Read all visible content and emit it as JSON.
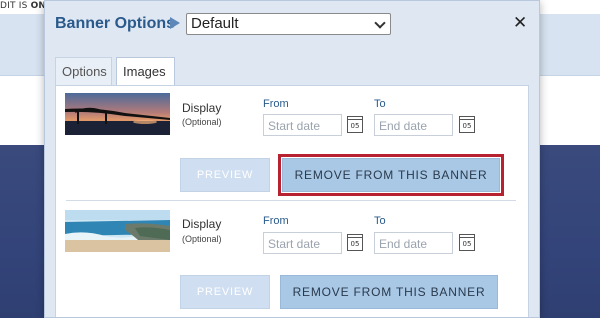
{
  "background": {
    "topbar_text": "DIT IS ON"
  },
  "dialog": {
    "title": "Banner Options",
    "banner_select": {
      "selected": "Default"
    },
    "tabs": [
      {
        "label": "Options",
        "active": false
      },
      {
        "label": "Images",
        "active": true
      }
    ],
    "images": [
      {
        "thumbnail": "bridge-sunset-image",
        "display_label": "Display",
        "optional_label": "(Optional)",
        "from_label": "From",
        "to_label": "To",
        "start_placeholder": "Start date",
        "end_placeholder": "End date",
        "calendar_day": "05",
        "preview_label": "PREVIEW",
        "remove_label": "REMOVE FROM THIS BANNER",
        "remove_focused": true
      },
      {
        "thumbnail": "beach-coast-image",
        "display_label": "Display",
        "optional_label": "(Optional)",
        "from_label": "From",
        "to_label": "To",
        "start_placeholder": "Start date",
        "end_placeholder": "End date",
        "calendar_day": "05",
        "preview_label": "PREVIEW",
        "remove_label": "REMOVE FROM THIS BANNER",
        "remove_focused": false
      }
    ]
  },
  "colors": {
    "title": "#2a5a8c",
    "remove_button": "#a9c8e6",
    "preview_button": "#cfdef0",
    "focus_ring": "#b8212f"
  }
}
